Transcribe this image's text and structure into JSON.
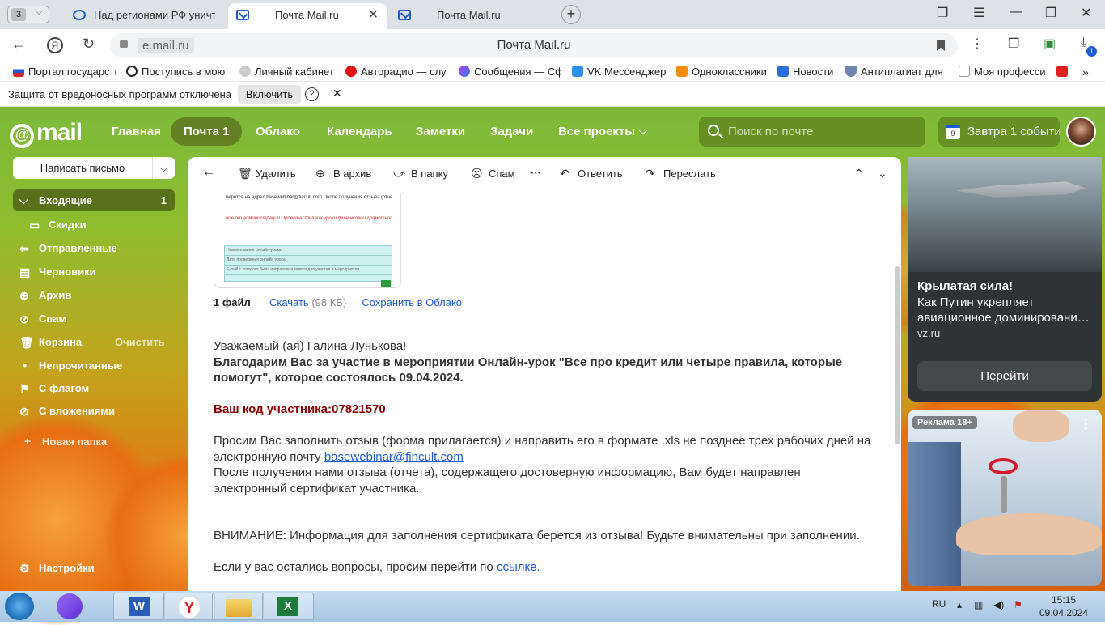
{
  "browser": {
    "tab_count": "3",
    "tabs": [
      {
        "title": "Над регионами РФ уничтоже",
        "active": false
      },
      {
        "title": "Почта Mail.ru",
        "active": true
      },
      {
        "title": "Почта Mail.ru",
        "active": false
      }
    ],
    "domain": "e.mail.ru",
    "page_title": "Почта Mail.ru",
    "download_badge": "1",
    "bookmarks": [
      {
        "label": "Портал государств"
      },
      {
        "label": "Поступись в мою"
      },
      {
        "label": "Личный кабинет"
      },
      {
        "label": "Авторадио — слу"
      },
      {
        "label": "Сообщения — Сф"
      },
      {
        "label": "VK Мессенджер"
      },
      {
        "label": "Одноклассники"
      },
      {
        "label": "Новости"
      },
      {
        "label": "Антиплагиат для"
      },
      {
        "label": "Моя професси"
      }
    ],
    "protection": {
      "text": "Защита от вредоносных программ отключена",
      "button": "Включить",
      "help": "?",
      "close": "✕"
    }
  },
  "mail": {
    "logo": "mail",
    "nav": [
      {
        "label": "Главная"
      },
      {
        "label": "Почта 1"
      },
      {
        "label": "Облако"
      },
      {
        "label": "Календарь"
      },
      {
        "label": "Заметки"
      },
      {
        "label": "Задачи"
      },
      {
        "label": "Все проекты"
      }
    ],
    "search_placeholder": "Поиск по почте",
    "calendar_day": "9",
    "tomorrow": "Завтра 1 событие",
    "compose": "Написать письмо",
    "folders": [
      {
        "label": "Входящие",
        "count": "1"
      },
      {
        "label": "Скидки"
      },
      {
        "label": "Отправленные"
      },
      {
        "label": "Черновики"
      },
      {
        "label": "Архив"
      },
      {
        "label": "Спам"
      },
      {
        "label": "Корзина",
        "action": "Очистить"
      },
      {
        "label": "Непрочитанные"
      },
      {
        "label": "С флагом"
      },
      {
        "label": "С вложениями"
      }
    ],
    "new_folder": "Новая папка",
    "settings": "Настройки",
    "toolbar": {
      "delete": "Удалить",
      "archive": "В архив",
      "to_folder": "В папку",
      "spam": "Спам",
      "more": "···",
      "reply": "Ответить",
      "forward": "Переслать"
    },
    "attachment": {
      "count": "1 файл",
      "download": "Скачать",
      "size": "(98 КБ)",
      "save_cloud": "Сохранить в Облако",
      "preview_line1": "берется на адрес basewebinar@fincult.com После получения отзыва (отчета)",
      "preview_line2": "ние от администрации Проекта \"Онлайн уроки финансовой грамотности\"",
      "preview_rows": [
        "Наименование онлайн-урока",
        "Дата проведения онлайн урока",
        "E-mail с которого была направлена заявка для участия в мероприятии"
      ]
    },
    "letter": {
      "greeting": "Уважаемый (ая) Галина Лунькова!",
      "thanks": "Благодарим Вас за участие в мероприятии Онлайн-урок \"Все про кредит или четыре правила, которые помогут\", которое состоялось 09.04.2024.",
      "code": "Ваш код участника:07821570",
      "request": "Просим Вас заполнить отзыв (форма прилагается) и направить его в формате .xls не позднее трех рабочих дней на электронную почту",
      "email": "basewebinar@fincult.com",
      "after": "После получения нами отзыва (отчета), содержащего достоверную информацию, Вам будет направлен электронный сертификат участника.",
      "attention": "ВНИМАНИЕ: Информация для заполнения сертификата берется из отзыва! Будьте внимательны при заполнении.",
      "questions": "Если у вас остались вопросы, просим перейти по",
      "link": "ссылке."
    }
  },
  "ads": {
    "news": {
      "headline": "Крылатая сила!",
      "text": "Как Путин укрепляет авиационное доминировани…",
      "source": "vz.ru",
      "button": "Перейти"
    },
    "promo": {
      "tag": "Реклама 18+",
      "menu": "⋮"
    }
  },
  "taskbar": {
    "lang": "RU",
    "time": "15:15",
    "date": "09.04.2024"
  }
}
